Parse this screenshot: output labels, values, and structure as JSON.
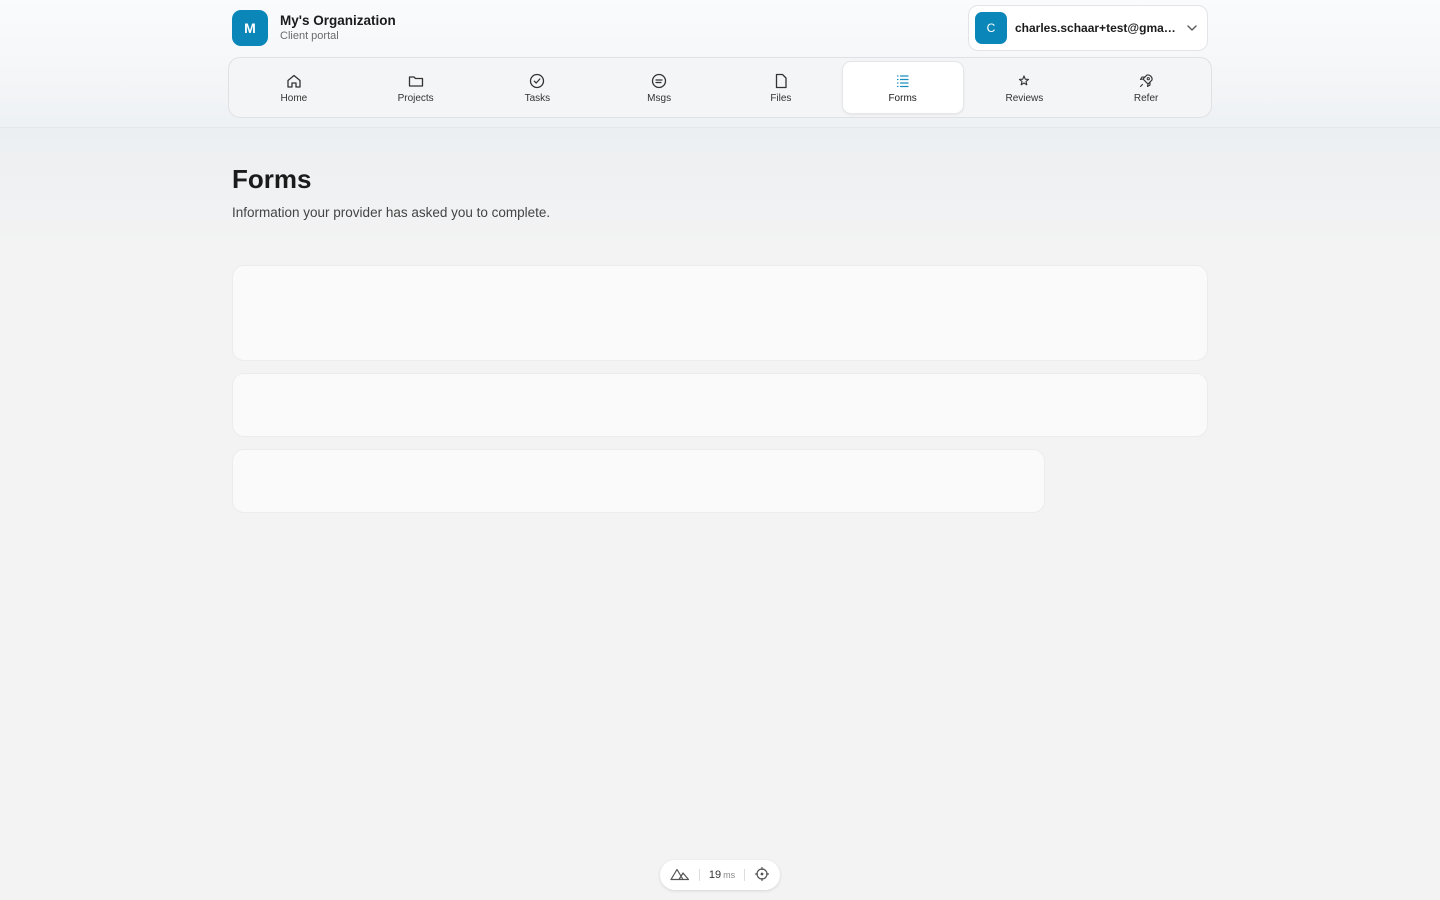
{
  "org": {
    "initial": "M",
    "name": "My's Organization",
    "subtitle": "Client portal"
  },
  "account": {
    "initial": "C",
    "email": "charles.schaar+test@gmail...."
  },
  "nav": {
    "items": [
      {
        "label": "Home",
        "icon": "home-icon"
      },
      {
        "label": "Projects",
        "icon": "folder-icon"
      },
      {
        "label": "Tasks",
        "icon": "check-circle-icon"
      },
      {
        "label": "Msgs",
        "icon": "message-icon"
      },
      {
        "label": "Files",
        "icon": "file-icon"
      },
      {
        "label": "Forms",
        "icon": "list-icon",
        "active": true
      },
      {
        "label": "Reviews",
        "icon": "star-icon"
      },
      {
        "label": "Refer",
        "icon": "rocket-icon"
      }
    ]
  },
  "page": {
    "title": "Forms",
    "subtitle": "Information your provider has asked you to complete."
  },
  "devbar": {
    "value": "19",
    "unit": "ms"
  },
  "colors": {
    "accent": "#0a87b8",
    "active_icon": "#1a8fbf"
  }
}
